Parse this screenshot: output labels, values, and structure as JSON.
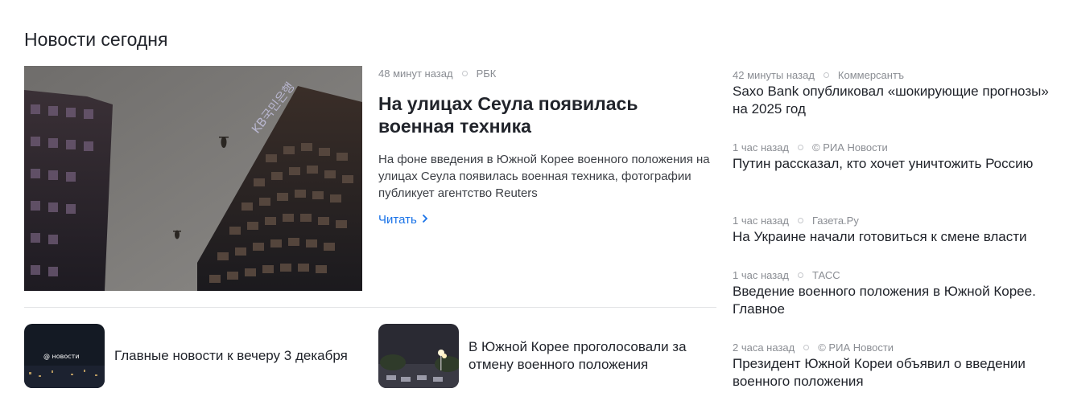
{
  "section": {
    "title": "Новости сегодня"
  },
  "hero": {
    "time": "48 минут назад",
    "source": "РБК",
    "title": "На улицах Сеула появилась военная техника",
    "description": "На фоне введения в Южной Корее военного положения на улицах Сеула появилась военная техника, фотографии публикует агентство Reuters",
    "read_label": "Читать",
    "image_sign_text": "KB국민은행"
  },
  "cards": [
    {
      "title": "Главные новости к вечеру 3 декабря",
      "thumb_text": "@ новости"
    },
    {
      "title": "В Южной Корее проголосовали за отмену военного положения"
    }
  ],
  "side_news": [
    {
      "time": "42 минуты назад",
      "source": "Коммерсантъ",
      "title": "Saxo Bank опубликовал «шокирующие прогнозы» на 2025 год"
    },
    {
      "time": "1 час назад",
      "source": "© РИА Новости",
      "title": "Путин рассказал, кто хочет уничтожить Россию"
    },
    {
      "time": "1 час назад",
      "source": "Газета.Ру",
      "title": "На Украине начали готовиться к смене власти"
    },
    {
      "time": "1 час назад",
      "source": "ТАСС",
      "title": "Введение военного положения в Южной Корее. Главное"
    },
    {
      "time": "2 часа назад",
      "source": "© РИА Новости",
      "title": "Президент Южной Кореи объявил о введении военного положения"
    }
  ],
  "colors": {
    "link": "#1a73e8",
    "meta": "#8a8d93",
    "text": "#21242b"
  }
}
